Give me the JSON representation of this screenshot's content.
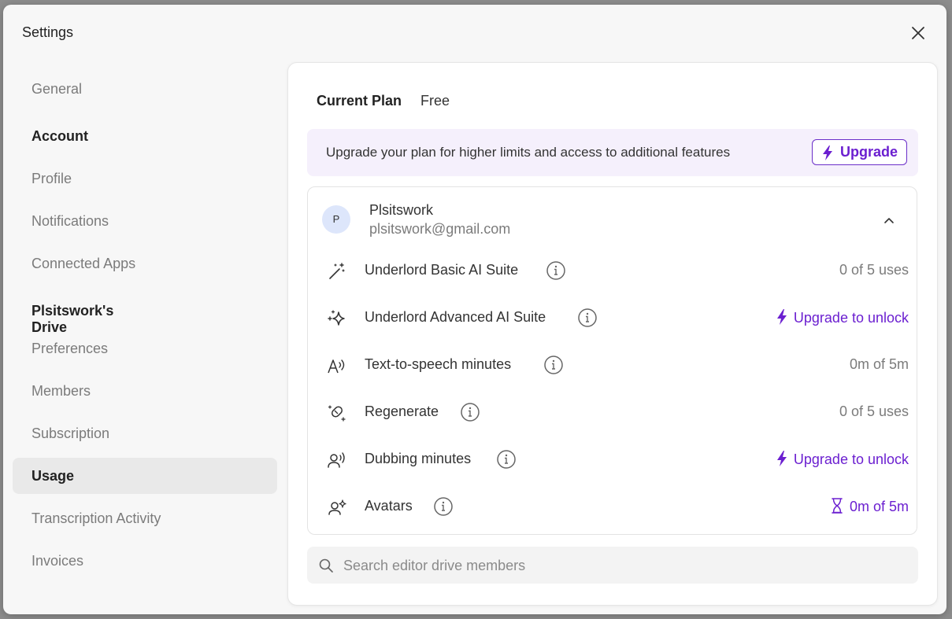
{
  "window": {
    "title": "Settings"
  },
  "sidebar": {
    "general": "General",
    "account_heading": "Account",
    "profile": "Profile",
    "notifications": "Notifications",
    "connected_apps": "Connected Apps",
    "drive_heading": "Plsitswork's Drive",
    "preferences": "Preferences",
    "members": "Members",
    "subscription": "Subscription",
    "usage": "Usage",
    "transcription_activity": "Transcription Activity",
    "invoices": "Invoices",
    "active_item": "Usage"
  },
  "plan": {
    "label": "Current Plan",
    "value": "Free",
    "banner_text": "Upgrade your plan for higher limits and access to additional features",
    "upgrade_button": "Upgrade"
  },
  "user": {
    "initial": "P",
    "name": "Plsitswork",
    "email": "plsitswork@gmail.com"
  },
  "usage": [
    {
      "icon": "magic-wand-icon",
      "label": "Underlord Basic AI Suite",
      "value": "0 of 5 uses",
      "style": "muted"
    },
    {
      "icon": "sparkles-icon",
      "label": "Underlord Advanced AI Suite",
      "value": "Upgrade to unlock",
      "style": "upgrade"
    },
    {
      "icon": "text-to-speech-icon",
      "label": "Text-to-speech minutes",
      "value": "0m of 5m",
      "style": "muted"
    },
    {
      "icon": "regenerate-icon",
      "label": "Regenerate",
      "value": "0 of 5 uses",
      "style": "muted"
    },
    {
      "icon": "dubbing-icon",
      "label": "Dubbing minutes",
      "value": "Upgrade to unlock",
      "style": "upgrade"
    },
    {
      "icon": "avatar-sparkle-icon",
      "label": "Avatars",
      "value": "0m of 5m",
      "style": "hourglass"
    }
  ],
  "search": {
    "placeholder": "Search editor drive members",
    "value": ""
  },
  "colors": {
    "accent": "#6b1fd0",
    "banner_bg": "#f5f0fc",
    "active_nav_bg": "#e9e9e9"
  }
}
